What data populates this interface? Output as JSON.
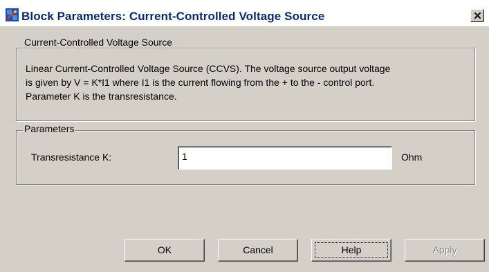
{
  "window": {
    "title": "Block Parameters: Current-Controlled Voltage Source",
    "icon": "simulink-block-icon",
    "close_icon": "close-icon"
  },
  "description_group": {
    "legend": "Current-Controlled Voltage Source",
    "lines": [
      "Linear Current-Controlled Voltage Source (CCVS). The voltage source output voltage",
      "is given by V = K*I1 where I1 is the current flowing from the + to the - control port.",
      "Parameter K is the transresistance."
    ]
  },
  "parameters_group": {
    "legend": "Parameters",
    "fields": [
      {
        "label": "Transresistance K:",
        "value": "1",
        "unit": "Ohm"
      }
    ]
  },
  "buttons": {
    "ok": "OK",
    "cancel": "Cancel",
    "help": "Help",
    "apply": "Apply"
  }
}
